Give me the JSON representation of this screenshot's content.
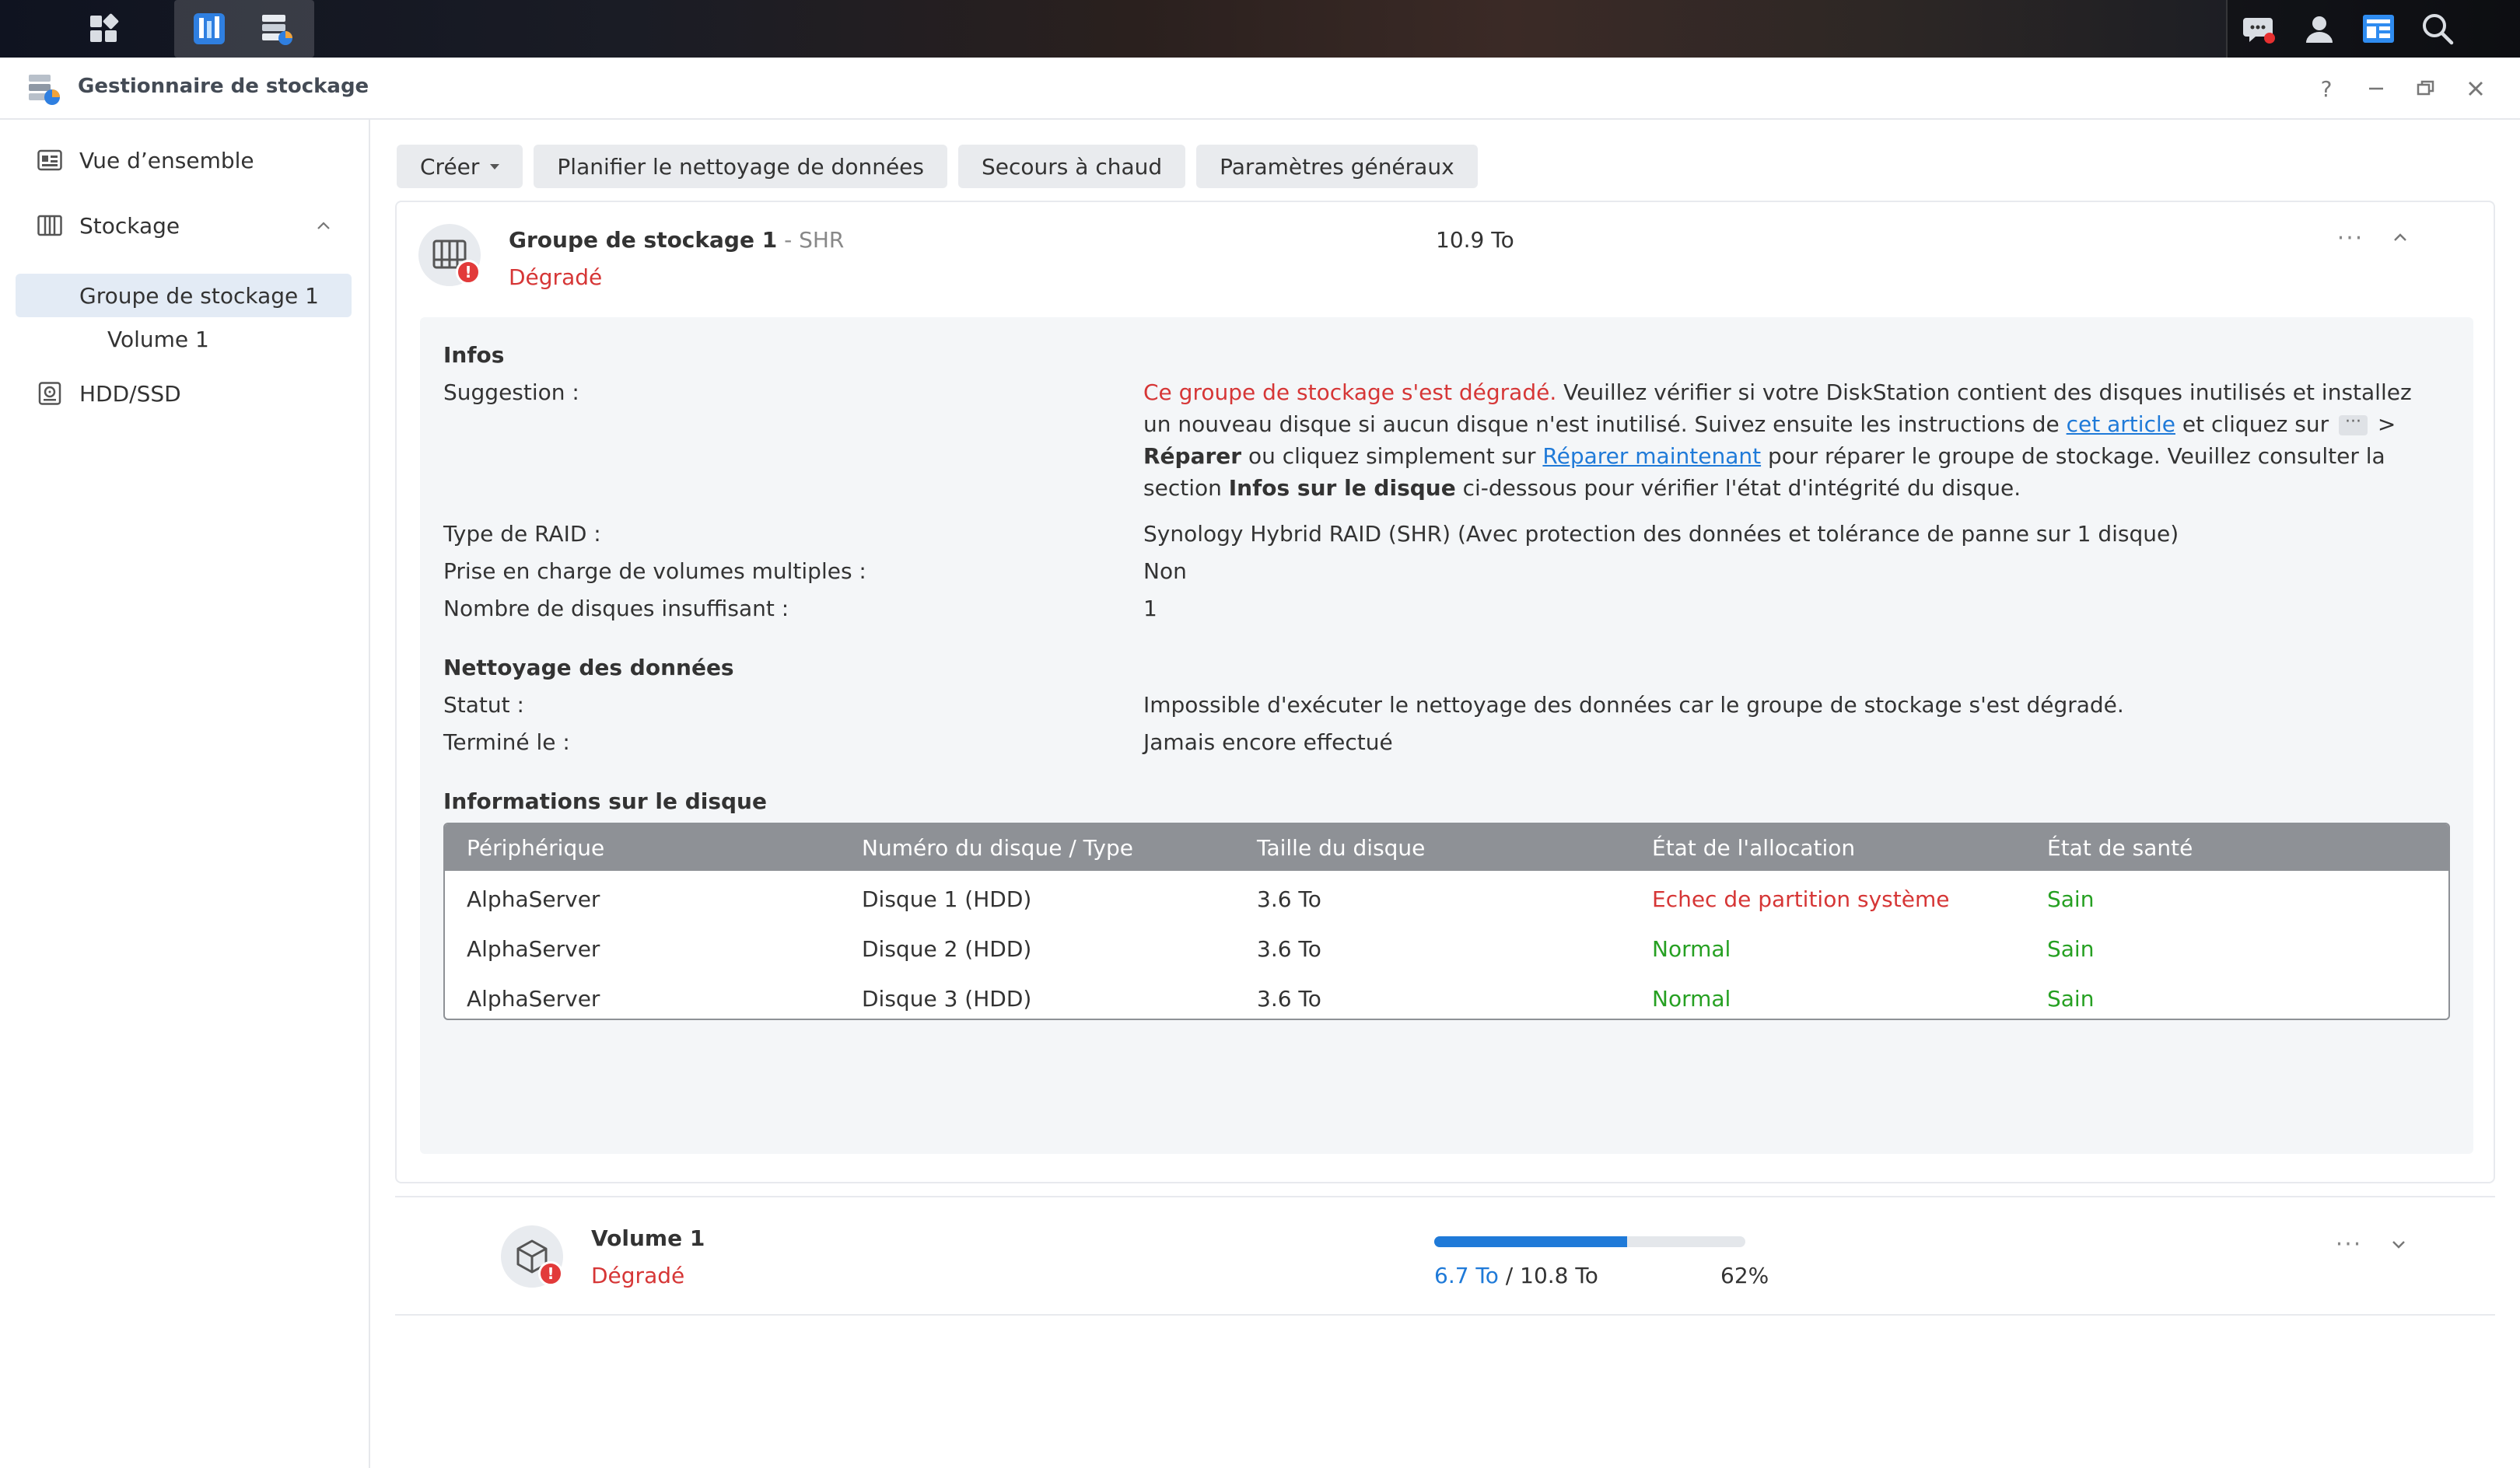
{
  "app": {
    "title": "Gestionnaire de stockage",
    "window_controls": {
      "help": "?",
      "minimize": "–",
      "restore": "⧉",
      "close": "✕"
    }
  },
  "colors": {
    "accent": "#1f7ad8",
    "danger": "#d63636",
    "ok": "#26a022"
  },
  "taskbar": {
    "icons": [
      "main-menu-icon",
      "package-center-icon",
      "storage-manager-icon"
    ],
    "right_icons": [
      "chat-icon",
      "user-icon",
      "widgets-icon",
      "search-icon"
    ]
  },
  "sidebar": {
    "overview": "Vue d’ensemble",
    "storage": "Stockage",
    "pool": "Groupe de stockage 1",
    "volume": "Volume 1",
    "hdd": "HDD/SSD"
  },
  "toolbar": {
    "create": "Créer",
    "schedule": "Planifier le nettoyage de données",
    "hot_spare": "Secours à chaud",
    "settings": "Paramètres généraux"
  },
  "pool": {
    "name": "Groupe de stockage 1",
    "type": " - SHR",
    "status": "Dégradé",
    "size": "10.9 To",
    "more": "···",
    "badge": "!"
  },
  "infos": {
    "title": "Infos",
    "suggestion_label": "Suggestion :",
    "suggestion": {
      "red": "Ce groupe de stockage s'est dégradé.",
      "p1": " Veuillez vérifier si votre DiskStation contient des disques inutilisés et installez un nouveau disque si aucun disque n'est inutilisé. Suivez ensuite les instructions de ",
      "link1": "cet article",
      "p2": " et cliquez sur ",
      "chip": "···",
      "p3": " > ",
      "repair": "Réparer",
      "p4": " ou cliquez simplement sur ",
      "link2": "Réparer maintenant",
      "p5": " pour réparer le groupe de stockage. Veuillez consulter la section ",
      "bold2": "Infos sur le disque",
      "p6": " ci-dessous pour vérifier l'état d'intégrité du disque."
    },
    "raid_label": "Type de RAID :",
    "raid_value": "Synology Hybrid RAID (SHR) (Avec protection des données et tolérance de panne sur 1 disque)",
    "multi_label": "Prise en charge de volumes multiples :",
    "multi_value": "Non",
    "missing_label": "Nombre de disques insuffisant :",
    "missing_value": "1"
  },
  "scrub": {
    "title": "Nettoyage des données",
    "status_label": "Statut :",
    "status_value": "Impossible d'exécuter le nettoyage des données car le groupe de stockage s'est dégradé.",
    "done_label": "Terminé le :",
    "done_value": "Jamais encore effectué"
  },
  "disks": {
    "title": "Informations sur le disque",
    "headers": [
      "Périphérique",
      "Numéro du disque / Type",
      "Taille du disque",
      "État de l'allocation",
      "État de santé"
    ],
    "rows": [
      [
        "AlphaServer",
        "Disque 1 (HDD)",
        "3.6 To",
        "Echec de partition système",
        "Sain"
      ],
      [
        "AlphaServer",
        "Disque 2 (HDD)",
        "3.6 To",
        "Normal",
        "Sain"
      ],
      [
        "AlphaServer",
        "Disque 3 (HDD)",
        "3.6 To",
        "Normal",
        "Sain"
      ]
    ]
  },
  "volume": {
    "name": "Volume 1",
    "status": "Dégradé",
    "used": "6.7 To",
    "total": " / 10.8 To",
    "percent": "62%",
    "usage_fraction": 0.62,
    "more": "···",
    "badge": "!"
  }
}
